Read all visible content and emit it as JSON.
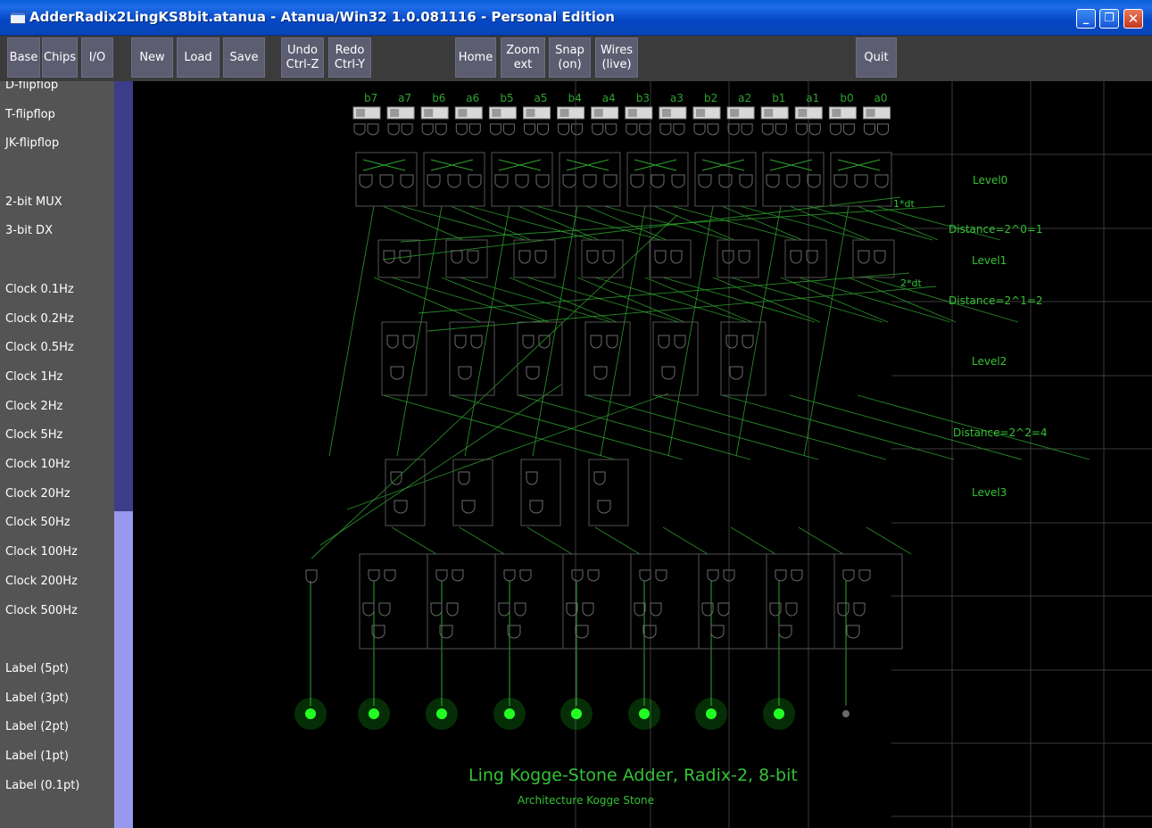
{
  "window": {
    "title": "AdderRadix2LingKS8bit.atanua - Atanua/Win32 1.0.081116 - Personal Edition",
    "min_label": "_",
    "max_label": "❐",
    "close_label": "✕"
  },
  "toolbar": {
    "base": "Base",
    "chips": "Chips",
    "io": "I/O",
    "new": "New",
    "load": "Load",
    "save": "Save",
    "undo": "Undo\nCtrl-Z",
    "redo": "Redo\nCtrl-Y",
    "home": "Home",
    "zoom": "Zoom\next",
    "snap": "Snap\n(on)",
    "wires": "Wires\n(live)",
    "quit": "Quit"
  },
  "sidebar": {
    "items": [
      "D-flipflop",
      "T-flipflop",
      "JK-flipflop",
      "2-bit MUX",
      "3-bit DX",
      "Clock 0.1Hz",
      "Clock 0.2Hz",
      "Clock 0.5Hz",
      "Clock 1Hz",
      "Clock 2Hz",
      "Clock 5Hz",
      "Clock 10Hz",
      "Clock 20Hz",
      "Clock 50Hz",
      "Clock 100Hz",
      "Clock 200Hz",
      "Clock 500Hz",
      "Label (5pt)",
      "Label (3pt)",
      "Label (2pt)",
      "Label (1pt)",
      "Label (0.1pt)"
    ]
  },
  "circuit": {
    "input_labels": [
      "b7",
      "a7",
      "b6",
      "a6",
      "b5",
      "a5",
      "b4",
      "a4",
      "b3",
      "a3",
      "b2",
      "a2",
      "b1",
      "a1",
      "b0",
      "a0"
    ],
    "level_labels": [
      "Level0",
      "Level1",
      "Level2",
      "Level3"
    ],
    "distance_labels": [
      "Distance=2^0=1",
      "Distance=2^1=2",
      "Distance=2^2=4"
    ],
    "delay_labels": [
      "1*dt",
      "2*dt"
    ],
    "title": "Ling Kogge-Stone Adder, Radix-2, 8-bit",
    "subtitle": "Architecture Kogge Stone",
    "colors": {
      "background": "#000000",
      "wire": "#2fa32f",
      "gate": "#6a6a6a",
      "led": "#22ff22",
      "grid": "#3a3a3a"
    }
  }
}
